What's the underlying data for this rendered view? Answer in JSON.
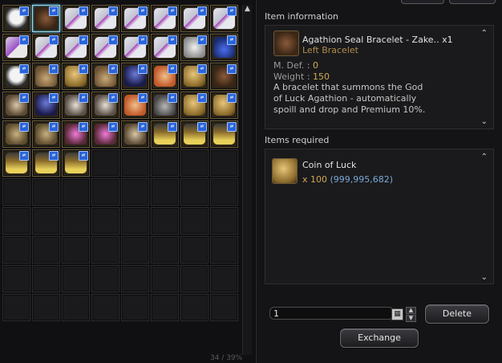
{
  "inventory": {
    "footer": "34 / 39%",
    "slots": [
      {
        "art": "c-panda",
        "badge": true
      },
      {
        "art": "c-brown",
        "badge": true,
        "selected": true
      },
      {
        "art": "c-gift",
        "badge": true
      },
      {
        "art": "c-gift",
        "badge": true
      },
      {
        "art": "c-gift",
        "badge": true
      },
      {
        "art": "c-gift",
        "badge": true
      },
      {
        "art": "c-gift",
        "badge": true
      },
      {
        "art": "c-gift",
        "badge": true
      },
      {
        "art": "c-gift2",
        "badge": true
      },
      {
        "art": "c-gift",
        "badge": true
      },
      {
        "art": "c-gift",
        "badge": true
      },
      {
        "art": "c-gift",
        "badge": true
      },
      {
        "art": "c-gift",
        "badge": true
      },
      {
        "art": "c-gift",
        "badge": true
      },
      {
        "art": "c-shell",
        "badge": true
      },
      {
        "art": "c-potion",
        "badge": true
      },
      {
        "art": "c-panda",
        "badge": true
      },
      {
        "art": "c-hat",
        "badge": true
      },
      {
        "art": "c-bronze",
        "badge": true
      },
      {
        "art": "c-hat",
        "badge": true
      },
      {
        "art": "c-blue",
        "badge": true
      },
      {
        "art": "c-cake",
        "badge": true
      },
      {
        "art": "c-bronze",
        "badge": true
      },
      {
        "art": "c-brown",
        "badge": true
      },
      {
        "art": "c-mask",
        "badge": true
      },
      {
        "art": "c-blue",
        "badge": true
      },
      {
        "art": "c-cat",
        "badge": true
      },
      {
        "art": "c-cat",
        "badge": true
      },
      {
        "art": "c-cake",
        "badge": true
      },
      {
        "art": "c-bell",
        "badge": true
      },
      {
        "art": "c-bronze",
        "badge": true
      },
      {
        "art": "c-bronze",
        "badge": true
      },
      {
        "art": "c-plat",
        "badge": true
      },
      {
        "art": "c-plat",
        "badge": true
      },
      {
        "art": "c-pink",
        "badge": true
      },
      {
        "art": "c-pink",
        "badge": true
      },
      {
        "art": "c-mask",
        "badge": true
      },
      {
        "art": "c-lantern",
        "badge": true
      },
      {
        "art": "c-lantern",
        "badge": true
      },
      {
        "art": "c-lantern",
        "badge": true
      },
      {
        "art": "c-lantern",
        "badge": true
      },
      {
        "art": "c-lantern",
        "badge": true
      },
      {
        "art": "c-lantern",
        "badge": true
      }
    ],
    "total_slots": 88
  },
  "item_info": {
    "title": "Item information",
    "name": "Agathion Seal Bracelet - Zake..",
    "count": "x1",
    "slot_type": "Left Bracelet",
    "mdef_label": "M. Def. : ",
    "mdef_value": "0",
    "weight_label": "Weight : ",
    "weight_value": "150",
    "description": "A bracelet that summons the God of Luck Agathion - automatically spoill and drop and Premium 10%."
  },
  "required": {
    "title": "Items required",
    "name": "Coin of Luck",
    "qty": "x 100",
    "owned": "(999,995,682)"
  },
  "controls": {
    "quantity_value": "1",
    "delete_label": "Delete",
    "exchange_label": "Exchange"
  }
}
